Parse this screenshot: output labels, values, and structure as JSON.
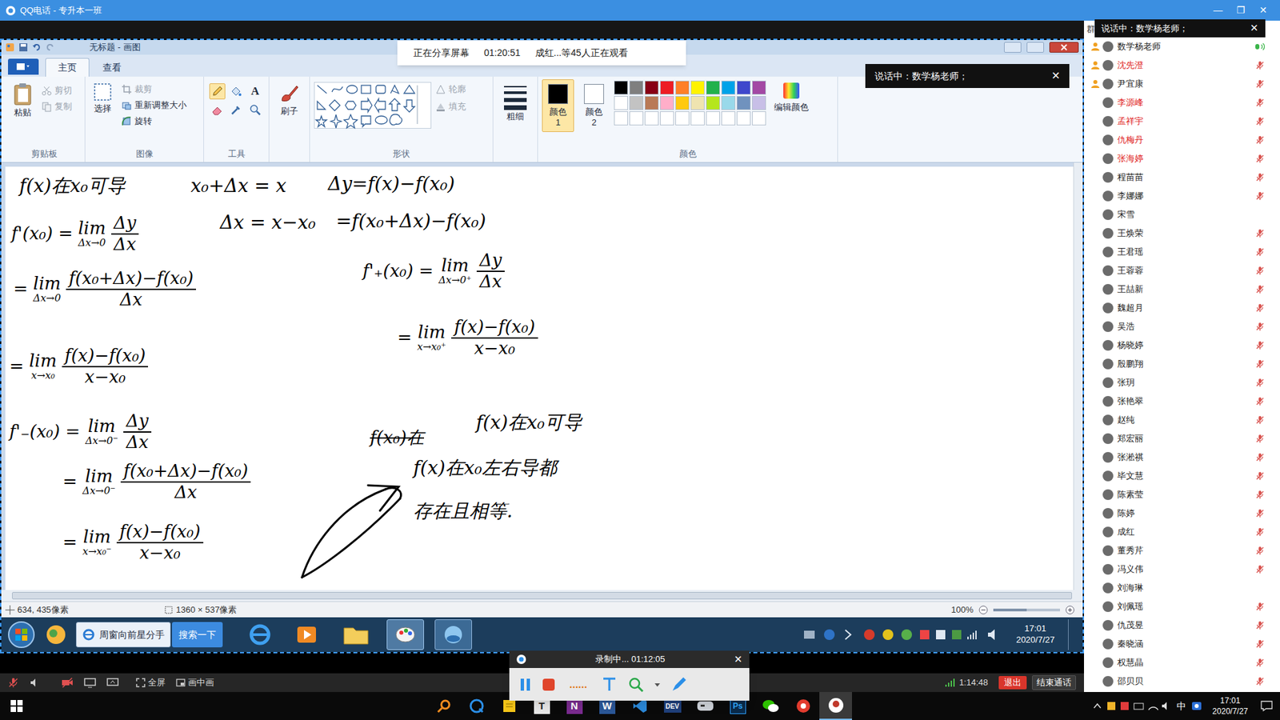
{
  "qq_window": {
    "title": "QQ电话 - 专升本一班",
    "controls": [
      "—",
      "❐",
      "✕"
    ]
  },
  "panel_header": "群",
  "speaking_toast_top": {
    "text": "说话中：数学杨老师；",
    "close": "✕"
  },
  "share_banner": {
    "status": "正在分享屏幕",
    "elapsed": "01:20:51",
    "viewers": "成红...等45人正在观看"
  },
  "paint": {
    "title": "无标题 - 画图",
    "tabs": [
      {
        "label": "主页",
        "selected": true
      },
      {
        "label": "查看",
        "selected": false
      }
    ],
    "clipboard": {
      "paste": "粘贴",
      "group": "剪贴板",
      "items": [
        {
          "label": "剪切",
          "disabled": true
        },
        {
          "label": "复制",
          "disabled": true
        }
      ]
    },
    "image": {
      "select": "选择",
      "group": "图像",
      "items": [
        {
          "label": "裁剪",
          "disabled": true
        },
        {
          "label": "重新调整大小",
          "disabled": false
        },
        {
          "label": "旋转",
          "disabled": false
        }
      ]
    },
    "tools": {
      "group": "工具",
      "items": [
        {
          "kind": "pencil",
          "selected": true
        },
        {
          "kind": "fill",
          "selected": false
        },
        {
          "kind": "text",
          "label": "A",
          "selected": false
        },
        {
          "kind": "eraser",
          "selected": false
        },
        {
          "kind": "picker",
          "selected": false
        },
        {
          "kind": "magnifier",
          "selected": false
        }
      ]
    },
    "brushes": {
      "label": "刷子"
    },
    "shapes": {
      "group": "形状",
      "items": [
        {
          "label": "轮廓",
          "disabled": true
        },
        {
          "label": "填充",
          "disabled": true
        }
      ]
    },
    "size": {
      "label": "粗细"
    },
    "color1": {
      "label": "颜色 1",
      "color": "#000000",
      "selected": true
    },
    "color2": {
      "label": "颜色 2",
      "color": "#ffffff",
      "selected": false
    },
    "palette": [
      [
        "#000000",
        "#7f7f7f",
        "#880015",
        "#ed1c24",
        "#ff7f27",
        "#fff200",
        "#22b14c",
        "#00a2e8",
        "#3f48cc",
        "#a349a4"
      ],
      [
        "#ffffff",
        "#c3c3c3",
        "#b97a57",
        "#ffaec9",
        "#ffc90e",
        "#efe4b0",
        "#b5e61d",
        "#99d9ea",
        "#7092be",
        "#c8bfe7"
      ],
      [
        "#ffffff",
        "#ffffff",
        "#ffffff",
        "#ffffff",
        "#ffffff",
        "#ffffff",
        "#ffffff",
        "#ffffff",
        "#ffffff",
        "#ffffff"
      ]
    ],
    "palette_group": "颜色",
    "edit_colors": "编辑颜色",
    "drawing": [
      {
        "kind": "text",
        "text": "f(x)在x₀可导"
      },
      {
        "kind": "limit",
        "lhs": "f'(x₀) =",
        "lim": "lim",
        "sub": "Δx→0",
        "num": "Δy",
        "den": "Δx"
      },
      {
        "kind": "limit",
        "lhs": "=",
        "lim": "lim",
        "sub": "Δx→0",
        "num": "f(x₀+Δx)−f(x₀)",
        "den": "Δx"
      },
      {
        "kind": "limit",
        "lhs": "=",
        "lim": "lim",
        "sub": "x→x₀",
        "num": "f(x)−f(x₀)",
        "den": "x−x₀"
      },
      {
        "kind": "limit",
        "lhs": "f'₋(x₀) =",
        "lim": "lim",
        "sub": "Δx→0⁻",
        "num": "Δy",
        "den": "Δx"
      },
      {
        "kind": "limit",
        "lhs": "=",
        "lim": "lim",
        "sub": "Δx→0⁻",
        "num": "f(x₀+Δx)−f(x₀)",
        "den": "Δx"
      },
      {
        "kind": "limit",
        "lhs": "=",
        "lim": "lim",
        "sub": "x→x₀⁻",
        "num": "f(x)−f(x₀)",
        "den": "x−x₀"
      },
      {
        "kind": "text",
        "text": "x₀+Δx = x"
      },
      {
        "kind": "text",
        "text": "Δx = x−x₀"
      },
      {
        "kind": "text",
        "text": "Δy=f(x)−f(x₀)"
      },
      {
        "kind": "text",
        "text": "=f(x₀+Δx)−f(x₀)"
      },
      {
        "kind": "limit",
        "lhs": "f'₊(x₀) =",
        "lim": "lim",
        "sub": "Δx→0⁺",
        "num": "Δy",
        "den": "Δx"
      },
      {
        "kind": "limit",
        "lhs": "=",
        "lim": "lim",
        "sub": "x→x₀⁺",
        "num": "f(x)−f(x₀)",
        "den": "x−x₀"
      },
      {
        "kind": "struck",
        "text": "f(x₀)在"
      },
      {
        "kind": "text",
        "text": "f(x)在x₀可导"
      },
      {
        "kind": "text",
        "text": "f(x)在x₀左右导都"
      },
      {
        "kind": "text",
        "text": "存在且相等."
      }
    ],
    "status": {
      "cursor": "634, 435像素",
      "size": "1360 × 537像素",
      "zoom": "100%",
      "zoom_level": 0.5
    },
    "toast": {
      "text": "说话中：数学杨老师；",
      "close": "✕"
    }
  },
  "win7_taskbar": {
    "tab": "周窗向前星分手",
    "search": "搜索一下",
    "time": "17:01",
    "date": "2020/7/27"
  },
  "participants": [
    {
      "name": "数学杨老师",
      "admin": true,
      "muted": false,
      "speaking": true,
      "color": "#222222"
    },
    {
      "name": "沈先澄",
      "admin": true,
      "muted": true,
      "speaking": false,
      "color": "#e02020"
    },
    {
      "name": "尹宜康",
      "admin": true,
      "muted": true,
      "speaking": false,
      "color": "#222222"
    },
    {
      "name": "李源峰",
      "admin": false,
      "muted": true,
      "speaking": false,
      "color": "#e02020"
    },
    {
      "name": "孟祥宇",
      "admin": false,
      "muted": true,
      "speaking": false,
      "color": "#e02020"
    },
    {
      "name": "仇梅丹",
      "admin": false,
      "muted": true,
      "speaking": false,
      "color": "#e02020"
    },
    {
      "name": "张海婷",
      "admin": false,
      "muted": true,
      "speaking": false,
      "color": "#e02020"
    },
    {
      "name": "程苗苗",
      "admin": false,
      "muted": true,
      "speaking": false,
      "color": "#222222"
    },
    {
      "name": "李娜娜",
      "admin": false,
      "muted": true,
      "speaking": false,
      "color": "#222222"
    },
    {
      "name": "宋雪",
      "admin": false,
      "muted": false,
      "speaking": false,
      "color": "#222222"
    },
    {
      "name": "王焕荣",
      "admin": false,
      "muted": true,
      "speaking": false,
      "color": "#222222"
    },
    {
      "name": "王君瑶",
      "admin": false,
      "muted": true,
      "speaking": false,
      "color": "#222222"
    },
    {
      "name": "王蓉蓉",
      "admin": false,
      "muted": true,
      "speaking": false,
      "color": "#222222"
    },
    {
      "name": "王喆新",
      "admin": false,
      "muted": true,
      "speaking": false,
      "color": "#222222"
    },
    {
      "name": "魏超月",
      "admin": false,
      "muted": true,
      "speaking": false,
      "color": "#222222"
    },
    {
      "name": "吴浩",
      "admin": false,
      "muted": true,
      "speaking": false,
      "color": "#222222"
    },
    {
      "name": "杨晓婷",
      "admin": false,
      "muted": true,
      "speaking": false,
      "color": "#222222"
    },
    {
      "name": "殷鹏翔",
      "admin": false,
      "muted": true,
      "speaking": false,
      "color": "#222222"
    },
    {
      "name": "张玥",
      "admin": false,
      "muted": true,
      "speaking": false,
      "color": "#222222"
    },
    {
      "name": "张艳翠",
      "admin": false,
      "muted": true,
      "speaking": false,
      "color": "#222222"
    },
    {
      "name": "赵纯",
      "admin": false,
      "muted": true,
      "speaking": false,
      "color": "#222222"
    },
    {
      "name": "郑宏丽",
      "admin": false,
      "muted": true,
      "speaking": false,
      "color": "#222222"
    },
    {
      "name": "张淞祺",
      "admin": false,
      "muted": true,
      "speaking": false,
      "color": "#222222"
    },
    {
      "name": "毕文慧",
      "admin": false,
      "muted": true,
      "speaking": false,
      "color": "#222222"
    },
    {
      "name": "陈素莹",
      "admin": false,
      "muted": true,
      "speaking": false,
      "color": "#222222"
    },
    {
      "name": "陈婷",
      "admin": false,
      "muted": true,
      "speaking": false,
      "color": "#222222"
    },
    {
      "name": "成红",
      "admin": false,
      "muted": true,
      "speaking": false,
      "color": "#222222"
    },
    {
      "name": "董秀芹",
      "admin": false,
      "muted": true,
      "speaking": false,
      "color": "#222222"
    },
    {
      "name": "冯义伟",
      "admin": false,
      "muted": true,
      "speaking": false,
      "color": "#222222"
    },
    {
      "name": "刘海琳",
      "admin": false,
      "muted": false,
      "speaking": false,
      "color": "#222222"
    },
    {
      "name": "刘佩瑶",
      "admin": false,
      "muted": true,
      "speaking": false,
      "color": "#222222"
    },
    {
      "name": "仇茂昱",
      "admin": false,
      "muted": true,
      "speaking": false,
      "color": "#222222"
    },
    {
      "name": "秦晓涵",
      "admin": false,
      "muted": true,
      "speaking": false,
      "color": "#222222"
    },
    {
      "name": "权慧晶",
      "admin": false,
      "muted": true,
      "speaking": false,
      "color": "#222222"
    },
    {
      "name": "邵贝贝",
      "admin": false,
      "muted": true,
      "speaking": false,
      "color": "#222222"
    }
  ],
  "call_toolbar": {
    "fullscreen": "全屏",
    "pip": "画中画",
    "duration": "1:14:48",
    "exit": "退出",
    "end": "结束通话"
  },
  "recorder": {
    "status": "录制中... 01:12:05",
    "close": "✕",
    "dots": "......"
  },
  "taskbar": {
    "letters": [
      "T",
      "N",
      "W",
      "DEV",
      "Ps"
    ],
    "ime": "中",
    "time": "17:01",
    "date": "2020/7/27"
  }
}
